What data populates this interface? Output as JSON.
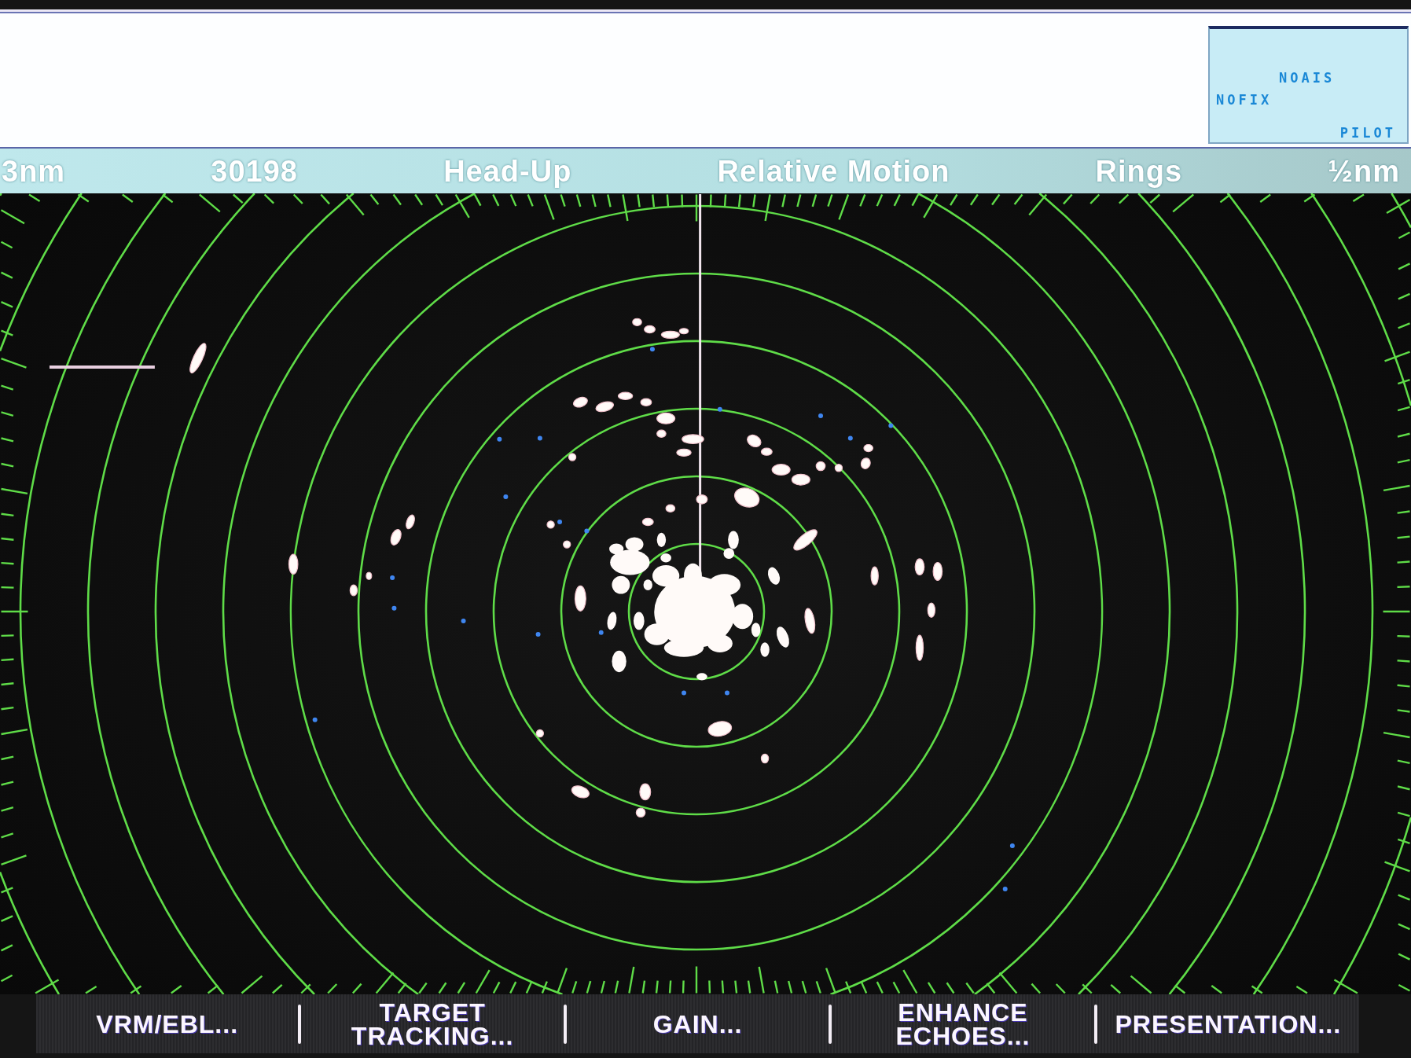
{
  "top_panel": {
    "indicators": [
      "NOAIS",
      "NOFIX",
      "PILOT"
    ]
  },
  "status_bar": {
    "items": [
      "3nm",
      "30198",
      "Head-Up",
      "Relative Motion",
      "Rings",
      "½nm"
    ]
  },
  "softkeys": [
    {
      "lines": [
        "VRM/EBL..."
      ]
    },
    {
      "lines": [
        "TARGET",
        "TRACKING..."
      ]
    },
    {
      "lines": [
        "GAIN..."
      ]
    },
    {
      "lines": [
        "ENHANCE",
        "ECHOES..."
      ]
    },
    {
      "lines": [
        "PRESENTATION..."
      ]
    }
  ]
}
